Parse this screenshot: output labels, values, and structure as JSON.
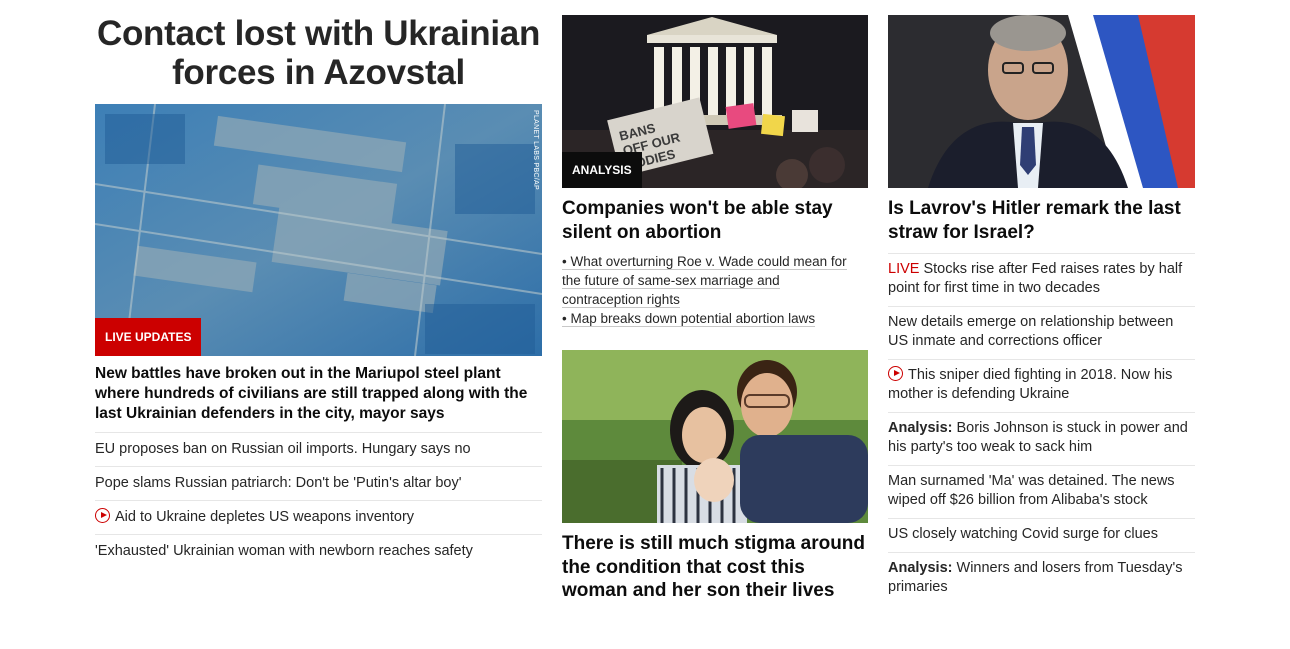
{
  "col1": {
    "headline": "Contact lost with Ukrainian forces in Azovstal",
    "image_credit": "PLANET LABS PBC/AP",
    "badge": "LIVE UPDATES",
    "lead": "New battles have broken out in the Mariupol steel plant where hundreds of civilians are still trapped along with the last Ukrainian defenders in the city, mayor says",
    "items": [
      "EU proposes ban on Russian oil imports. Hungary says no",
      "Pope slams Russian patriarch: Don't be 'Putin's altar boy'",
      "Aid to Ukraine depletes US weapons inventory",
      "'Exhausted' Ukrainian woman with newborn reaches safety"
    ]
  },
  "col2": {
    "story1": {
      "badge": "ANALYSIS",
      "sign_text": "BANS OFF OUR BODIES",
      "title": "Companies won't be able stay silent on abortion",
      "bullet1_a": "• What overturning Roe v. Wade could mean for",
      "bullet1_b": "the future of same-sex marriage and",
      "bullet1_c": "contraception rights",
      "bullet2": "• Map breaks down potential abortion laws"
    },
    "story2": {
      "title": "There is still much stigma around the condition that cost this woman and her son their lives"
    }
  },
  "col3": {
    "title": "Is Lavrov's Hitler remark the last straw for Israel?",
    "items": [
      {
        "prefix": "LIVE",
        "text": " Stocks rise after Fed raises rates by half point for first time in two decades"
      },
      {
        "prefix": "",
        "text": "New details emerge on relationship between US inmate and corrections officer"
      },
      {
        "prefix": "",
        "text": "This sniper died fighting in 2018. Now his mother is defending Ukraine"
      },
      {
        "prefix": "Analysis:",
        "text": " Boris Johnson is stuck in power and his party's too weak to sack him"
      },
      {
        "prefix": "",
        "text": "Man surnamed 'Ma' was detained. The news wiped off $26 billion from Alibaba's stock"
      },
      {
        "prefix": "",
        "text": "US closely watching Covid surge for clues"
      },
      {
        "prefix": "Analysis:",
        "text": " Winners and losers from Tuesday's primaries"
      }
    ]
  },
  "colors": {
    "accent_red": "#cc0000",
    "text": "#0c0c0c",
    "divider": "#e6e6e6"
  }
}
